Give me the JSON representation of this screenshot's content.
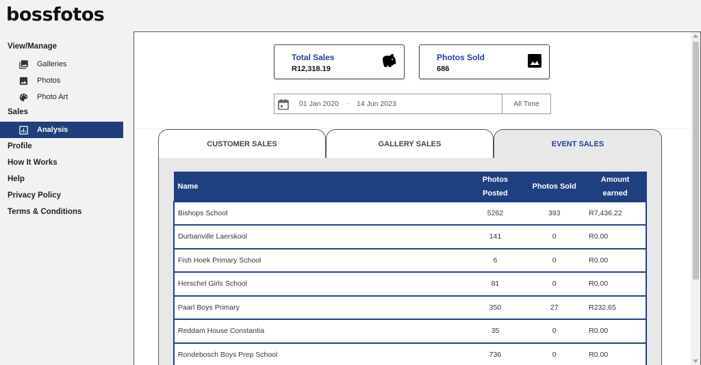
{
  "brand": {
    "logo_text": "bossfotos"
  },
  "sidebar": {
    "view_manage": "View/Manage",
    "galleries": "Galleries",
    "photos": "Photos",
    "photo_art": "Photo Art",
    "sales": "Sales",
    "analysis": "Analysis",
    "profile": "Profile",
    "how_it_works": "How It Works",
    "help": "Help",
    "privacy_policy": "Privacy Policy",
    "terms": "Terms & Conditions"
  },
  "stats": {
    "total_sales": {
      "label": "Total Sales",
      "value": "R12,318.19",
      "icon": "piggy-bank-icon"
    },
    "photos_sold": {
      "label": "Photos Sold",
      "value": "686",
      "icon": "image-icon"
    }
  },
  "date_range": {
    "start": "01 Jan 2020",
    "arrow": "→",
    "end": "14 Jun 2023",
    "preset": "All Time"
  },
  "tabs": {
    "customer": "CUSTOMER SALES",
    "gallery": "GALLERY SALES",
    "event": "EVENT SALES",
    "active": "event"
  },
  "table": {
    "headers": {
      "name": "Name",
      "posted_1": "Photos",
      "posted_2": "Posted",
      "sold": "Photos Sold",
      "amount_1": "Amount",
      "amount_2": "earned"
    },
    "rows": [
      {
        "name": "Bishops School",
        "posted": "5262",
        "sold": "393",
        "amount": "R7,436.22"
      },
      {
        "name": "Durbanville Laerskool",
        "posted": "141",
        "sold": "0",
        "amount": "R0.00"
      },
      {
        "name": "Fish Hoek Primary School",
        "posted": "6",
        "sold": "0",
        "amount": "R0.00"
      },
      {
        "name": "Herschel Girls School",
        "posted": "81",
        "sold": "0",
        "amount": "R0.00"
      },
      {
        "name": "Paarl Boys Primary",
        "posted": "350",
        "sold": "27",
        "amount": "R232.65"
      },
      {
        "name": "Reddam House Constantia",
        "posted": "35",
        "sold": "0",
        "amount": "R0.00"
      },
      {
        "name": "Rondebosch Boys Prep School",
        "posted": "736",
        "sold": "0",
        "amount": "R0.00"
      }
    ]
  },
  "colors": {
    "primary": "#1f4080",
    "accent_text": "#1f3f9a",
    "active_nav": "#1f3f7a"
  }
}
